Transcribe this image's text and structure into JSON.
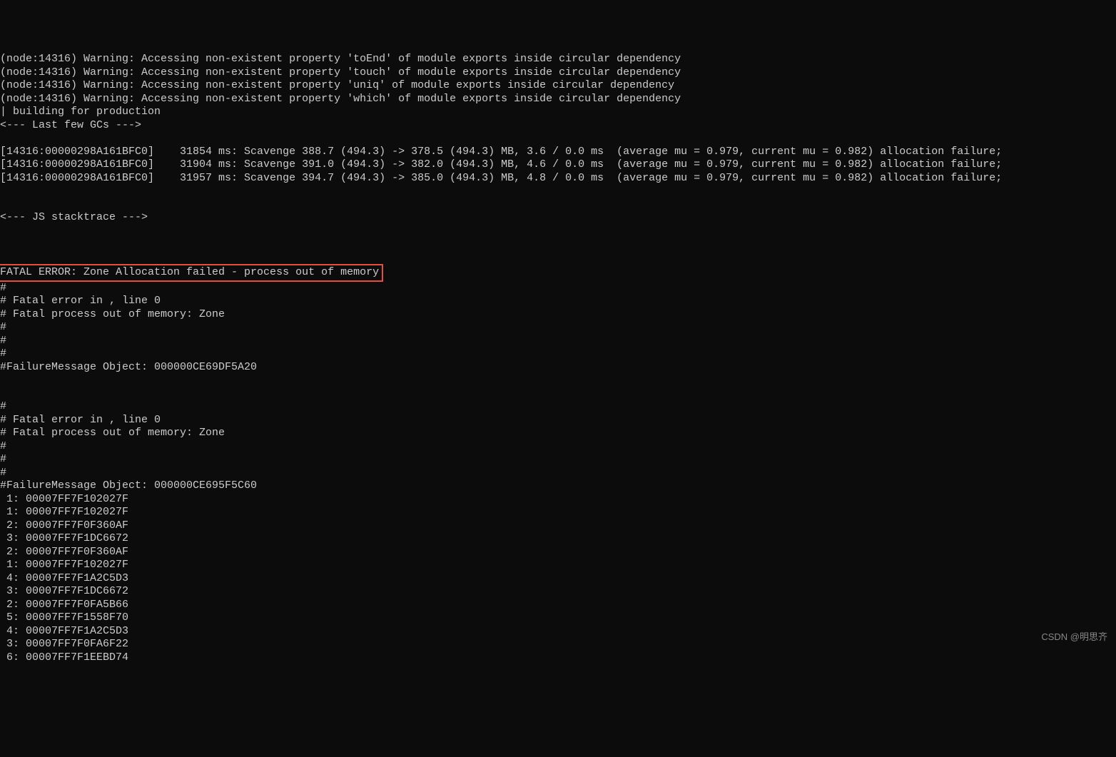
{
  "terminal": {
    "lines": [
      "(node:14316) Warning: Accessing non-existent property 'toEnd' of module exports inside circular dependency",
      "(node:14316) Warning: Accessing non-existent property 'touch' of module exports inside circular dependency",
      "(node:14316) Warning: Accessing non-existent property 'uniq' of module exports inside circular dependency",
      "(node:14316) Warning: Accessing non-existent property 'which' of module exports inside circular dependency",
      "| building for production",
      "<--- Last few GCs --->",
      "",
      "[14316:00000298A161BFC0]    31854 ms: Scavenge 388.7 (494.3) -> 378.5 (494.3) MB, 3.6 / 0.0 ms  (average mu = 0.979, current mu = 0.982) allocation failure;",
      "[14316:00000298A161BFC0]    31904 ms: Scavenge 391.0 (494.3) -> 382.0 (494.3) MB, 4.6 / 0.0 ms  (average mu = 0.979, current mu = 0.982) allocation failure;",
      "[14316:00000298A161BFC0]    31957 ms: Scavenge 394.7 (494.3) -> 385.0 (494.3) MB, 4.8 / 0.0 ms  (average mu = 0.979, current mu = 0.982) allocation failure;",
      "",
      "",
      "<--- JS stacktrace --->",
      "",
      "",
      "",
      "FATAL ERROR: Zone Allocation failed - process out of memory",
      "#",
      "# Fatal error in , line 0",
      "# Fatal process out of memory: Zone",
      "#",
      "#",
      "#",
      "#FailureMessage Object: 000000CE69DF5A20",
      "",
      "",
      "#",
      "# Fatal error in , line 0",
      "# Fatal process out of memory: Zone",
      "#",
      "#",
      "#",
      "#FailureMessage Object: 000000CE695F5C60",
      " 1: 00007FF7F102027F",
      " 1: 00007FF7F102027F",
      " 2: 00007FF7F0F360AF",
      " 3: 00007FF7F1DC6672",
      " 2: 00007FF7F0F360AF",
      " 1: 00007FF7F102027F",
      " 4: 00007FF7F1A2C5D3",
      " 3: 00007FF7F1DC6672",
      " 2: 00007FF7F0FA5B66",
      " 5: 00007FF7F1558F70",
      " 4: 00007FF7F1A2C5D3",
      " 3: 00007FF7F0FA6F22",
      " 6: 00007FF7F1EEBD74"
    ],
    "highlighted_line_index": 16
  },
  "watermark": "CSDN @明思齐"
}
